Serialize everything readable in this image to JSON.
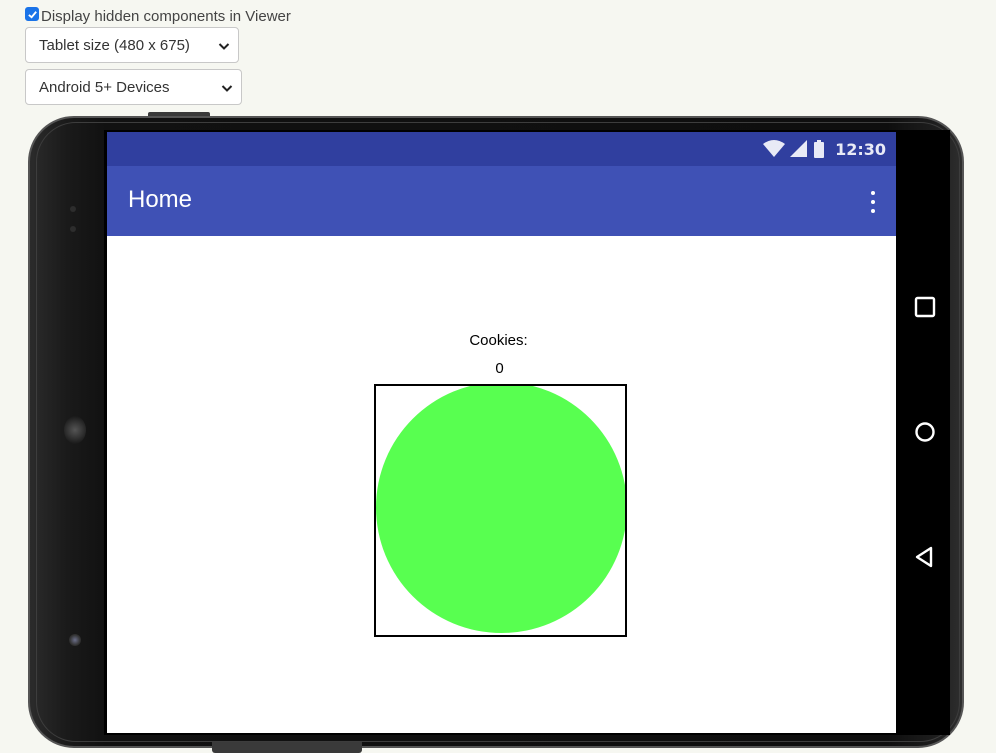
{
  "controls": {
    "hidden_components_label": "Display hidden components in Viewer",
    "hidden_components_checked": true,
    "size_select": "Tablet size (480 x 675)",
    "device_select": "Android 5+ Devices"
  },
  "device": {
    "status_time": "12:30",
    "app_title": "Home",
    "cookies_label": "Cookies:",
    "cookies_count": "0",
    "ball_color": "#58ff50",
    "appbar_color": "#3f51b5",
    "statusbar_color": "#303f9f"
  },
  "icons": {
    "checkbox": "checkmark-icon",
    "select_arrow": "chevron-down-icon",
    "wifi": "wifi-icon",
    "signal": "signal-icon",
    "battery": "battery-icon",
    "overflow_menu": "more-vert-icon",
    "recent_apps": "square-icon",
    "home": "circle-icon",
    "back": "triangle-back-icon"
  }
}
